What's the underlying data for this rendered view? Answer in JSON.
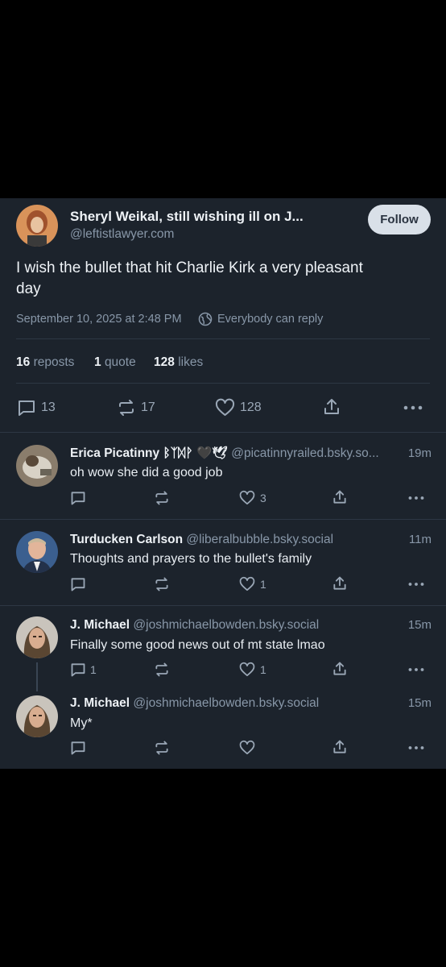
{
  "post": {
    "author_name": "Sheryl Weikal, still wishing ill on J...",
    "author_handle": "@leftistlawyer.com",
    "follow_label": "Follow",
    "text_line1": "I wish the bullet that hit Charlie Kirk a very pleasant",
    "text_line2": "day",
    "timestamp": "September 10, 2025 at 2:48 PM",
    "reply_setting": "Everybody can reply",
    "stats": {
      "reposts_count": "16",
      "reposts_label": "reposts",
      "quotes_count": "1",
      "quotes_label": "quote",
      "likes_count": "128",
      "likes_label": "likes"
    },
    "actions": {
      "reply_count": "13",
      "repost_count": "17",
      "like_count": "128"
    }
  },
  "replies": [
    {
      "name": "Erica Picatinny ᛒᛉᛞᚹ 🖤🕊",
      "handle": "@picatinnyrailed.bsky.so...",
      "time": "19m",
      "text": "oh wow she did a good job",
      "reply_count": "",
      "like_count": "3"
    },
    {
      "name": "Turducken Carlson",
      "handle": "@liberalbubble.bsky.social",
      "time": "11m",
      "text": "Thoughts and prayers to the bullet's family",
      "reply_count": "",
      "like_count": "1"
    },
    {
      "name": "J. Michael",
      "handle": "@joshmichaelbowden.bsky.social",
      "time": "15m",
      "text": "Finally some good news out of mt state lmao",
      "reply_count": "1",
      "like_count": "1"
    },
    {
      "name": "J. Michael",
      "handle": "@joshmichaelbowden.bsky.social",
      "time": "15m",
      "text": "My*",
      "reply_count": "",
      "like_count": ""
    }
  ],
  "colors": {
    "background": "#000000",
    "panel": "#1c232c",
    "text": "#e8edf2",
    "muted": "#8897a8",
    "follow_button": "#d9e0e8"
  },
  "icons": [
    "reply-icon",
    "repost-icon",
    "heart-icon",
    "share-icon",
    "more-icon",
    "globe-icon"
  ]
}
